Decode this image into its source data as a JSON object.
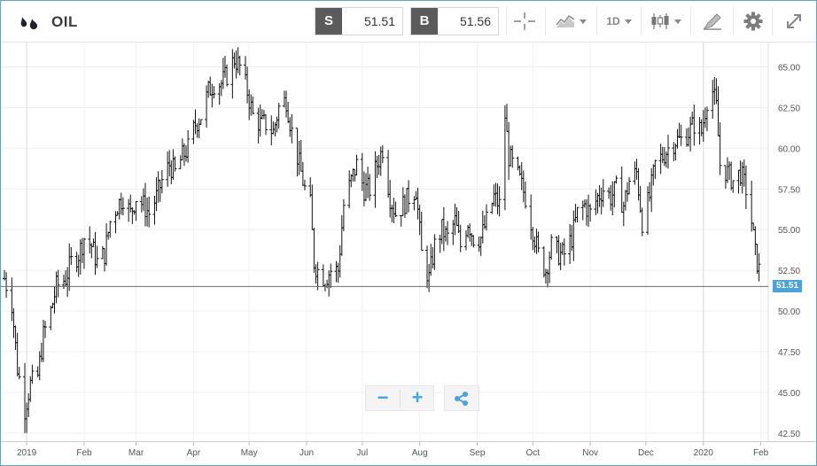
{
  "header": {
    "instrument": "OIL",
    "sell_label": "S",
    "sell_price": "51.51",
    "buy_label": "B",
    "buy_price": "51.56",
    "interval": "1D",
    "icons": [
      "oil-drops-icon",
      "crosshair-icon",
      "chart-type-icon",
      "candlestick-icon",
      "drawing-tools-icon",
      "gear-icon",
      "expand-icon"
    ]
  },
  "price_line": {
    "value": 51.51,
    "label": "51.51",
    "color": "#4aa3dc"
  },
  "controls": {
    "zoom_out": "−",
    "zoom_in": "+"
  },
  "chart_data": {
    "type": "ohlc",
    "y_ticks": [
      "65.00",
      "62.50",
      "60.00",
      "57.50",
      "55.00",
      "52.50",
      "50.00",
      "47.50",
      "45.00",
      "42.50"
    ],
    "y_tick_values": [
      65,
      62.5,
      60,
      57.5,
      55,
      52.5,
      50,
      47.5,
      45,
      42.5
    ],
    "ylim": [
      42.0,
      66.5
    ],
    "x_labels": [
      "2019",
      "Feb",
      "Mar",
      "Apr",
      "May",
      "Jun",
      "Jul",
      "Aug",
      "Sep",
      "Oct",
      "Nov",
      "Dec",
      "2020",
      "Feb"
    ],
    "x_label_dates": [
      "2019-01-01",
      "2019-02-01",
      "2019-03-01",
      "2019-04-01",
      "2019-05-01",
      "2019-06-01",
      "2019-07-01",
      "2019-08-01",
      "2019-09-01",
      "2019-10-01",
      "2019-11-01",
      "2019-12-01",
      "2020-01-01",
      "2020-02-01"
    ],
    "x_start": "2018-12-20",
    "x_end": "2020-02-05",
    "closes": [
      [
        "2018-12-20",
        52.0
      ],
      [
        "2018-12-24",
        50.5
      ],
      [
        "2018-12-27",
        46.5
      ],
      [
        "2018-12-31",
        44.0
      ],
      [
        "2019-01-03",
        45.5
      ],
      [
        "2019-01-07",
        46.0
      ],
      [
        "2019-01-10",
        48.5
      ],
      [
        "2019-01-14",
        50.0
      ],
      [
        "2019-01-17",
        51.5
      ],
      [
        "2019-01-22",
        52.0
      ],
      [
        "2019-01-25",
        53.0
      ],
      [
        "2019-01-29",
        53.5
      ],
      [
        "2019-02-01",
        54.5
      ],
      [
        "2019-02-05",
        54.0
      ],
      [
        "2019-02-08",
        53.0
      ],
      [
        "2019-02-12",
        53.5
      ],
      [
        "2019-02-15",
        55.5
      ],
      [
        "2019-02-19",
        56.5
      ],
      [
        "2019-02-22",
        57.0
      ],
      [
        "2019-02-26",
        56.0
      ],
      [
        "2019-03-01",
        57.0
      ],
      [
        "2019-03-05",
        56.5
      ],
      [
        "2019-03-08",
        56.0
      ],
      [
        "2019-03-12",
        57.0
      ],
      [
        "2019-03-15",
        58.0
      ],
      [
        "2019-03-19",
        59.0
      ],
      [
        "2019-03-22",
        58.5
      ],
      [
        "2019-03-26",
        59.5
      ],
      [
        "2019-03-29",
        60.0
      ],
      [
        "2019-04-02",
        61.5
      ],
      [
        "2019-04-05",
        62.0
      ],
      [
        "2019-04-09",
        63.5
      ],
      [
        "2019-04-12",
        64.0
      ],
      [
        "2019-04-16",
        64.0
      ],
      [
        "2019-04-19",
        64.5
      ],
      [
        "2019-04-23",
        65.5
      ],
      [
        "2019-04-26",
        65.0
      ],
      [
        "2019-04-30",
        63.5
      ],
      [
        "2019-05-03",
        62.0
      ],
      [
        "2019-05-07",
        61.5
      ],
      [
        "2019-05-10",
        61.5
      ],
      [
        "2019-05-14",
        61.0
      ],
      [
        "2019-05-17",
        62.5
      ],
      [
        "2019-05-21",
        63.0
      ],
      [
        "2019-05-24",
        61.0
      ],
      [
        "2019-05-28",
        59.0
      ],
      [
        "2019-05-31",
        57.5
      ],
      [
        "2019-06-03",
        56.5
      ],
      [
        "2019-06-05",
        53.0
      ],
      [
        "2019-06-07",
        52.5
      ],
      [
        "2019-06-11",
        52.0
      ],
      [
        "2019-06-14",
        52.5
      ],
      [
        "2019-06-18",
        52.5
      ],
      [
        "2019-06-21",
        56.5
      ],
      [
        "2019-06-25",
        58.0
      ],
      [
        "2019-06-28",
        59.0
      ],
      [
        "2019-07-02",
        57.5
      ],
      [
        "2019-07-05",
        57.5
      ],
      [
        "2019-07-09",
        59.0
      ],
      [
        "2019-07-12",
        60.0
      ],
      [
        "2019-07-16",
        57.0
      ],
      [
        "2019-07-19",
        56.0
      ],
      [
        "2019-07-23",
        56.5
      ],
      [
        "2019-07-26",
        57.0
      ],
      [
        "2019-07-30",
        57.5
      ],
      [
        "2019-08-02",
        53.5
      ],
      [
        "2019-08-06",
        52.0
      ],
      [
        "2019-08-09",
        54.0
      ],
      [
        "2019-08-13",
        55.0
      ],
      [
        "2019-08-16",
        54.5
      ],
      [
        "2019-08-20",
        55.5
      ],
      [
        "2019-08-23",
        54.0
      ],
      [
        "2019-08-27",
        55.5
      ],
      [
        "2019-08-30",
        54.5
      ],
      [
        "2019-09-03",
        54.5
      ],
      [
        "2019-09-06",
        55.5
      ],
      [
        "2019-09-10",
        57.0
      ],
      [
        "2019-09-13",
        56.5
      ],
      [
        "2019-09-16",
        62.0
      ],
      [
        "2019-09-18",
        59.5
      ],
      [
        "2019-09-20",
        59.0
      ],
      [
        "2019-09-24",
        58.0
      ],
      [
        "2019-09-27",
        57.0
      ],
      [
        "2019-10-01",
        55.0
      ],
      [
        "2019-10-04",
        53.5
      ],
      [
        "2019-10-08",
        52.5
      ],
      [
        "2019-10-11",
        54.0
      ],
      [
        "2019-10-15",
        53.5
      ],
      [
        "2019-10-18",
        53.5
      ],
      [
        "2019-10-22",
        54.5
      ],
      [
        "2019-10-25",
        56.0
      ],
      [
        "2019-10-29",
        56.5
      ],
      [
        "2019-11-01",
        56.0
      ],
      [
        "2019-11-05",
        57.0
      ],
      [
        "2019-11-08",
        57.5
      ],
      [
        "2019-11-12",
        57.0
      ],
      [
        "2019-11-15",
        57.5
      ],
      [
        "2019-11-19",
        56.5
      ],
      [
        "2019-11-22",
        58.0
      ],
      [
        "2019-11-26",
        58.5
      ],
      [
        "2019-11-29",
        55.5
      ],
      [
        "2019-12-03",
        57.0
      ],
      [
        "2019-12-06",
        59.0
      ],
      [
        "2019-12-10",
        59.5
      ],
      [
        "2019-12-13",
        60.0
      ],
      [
        "2019-12-17",
        60.5
      ],
      [
        "2019-12-20",
        60.5
      ],
      [
        "2019-12-24",
        61.0
      ],
      [
        "2019-12-27",
        61.5
      ],
      [
        "2019-12-31",
        61.0
      ],
      [
        "2020-01-03",
        63.0
      ],
      [
        "2020-01-06",
        63.5
      ],
      [
        "2020-01-08",
        62.5
      ],
      [
        "2020-01-10",
        59.0
      ],
      [
        "2020-01-14",
        58.5
      ],
      [
        "2020-01-17",
        58.0
      ],
      [
        "2020-01-21",
        58.5
      ],
      [
        "2020-01-24",
        57.5
      ],
      [
        "2020-01-27",
        55.5
      ],
      [
        "2020-01-29",
        53.5
      ],
      [
        "2020-01-31",
        52.5
      ],
      [
        "2020-02-03",
        51.5
      ]
    ]
  }
}
